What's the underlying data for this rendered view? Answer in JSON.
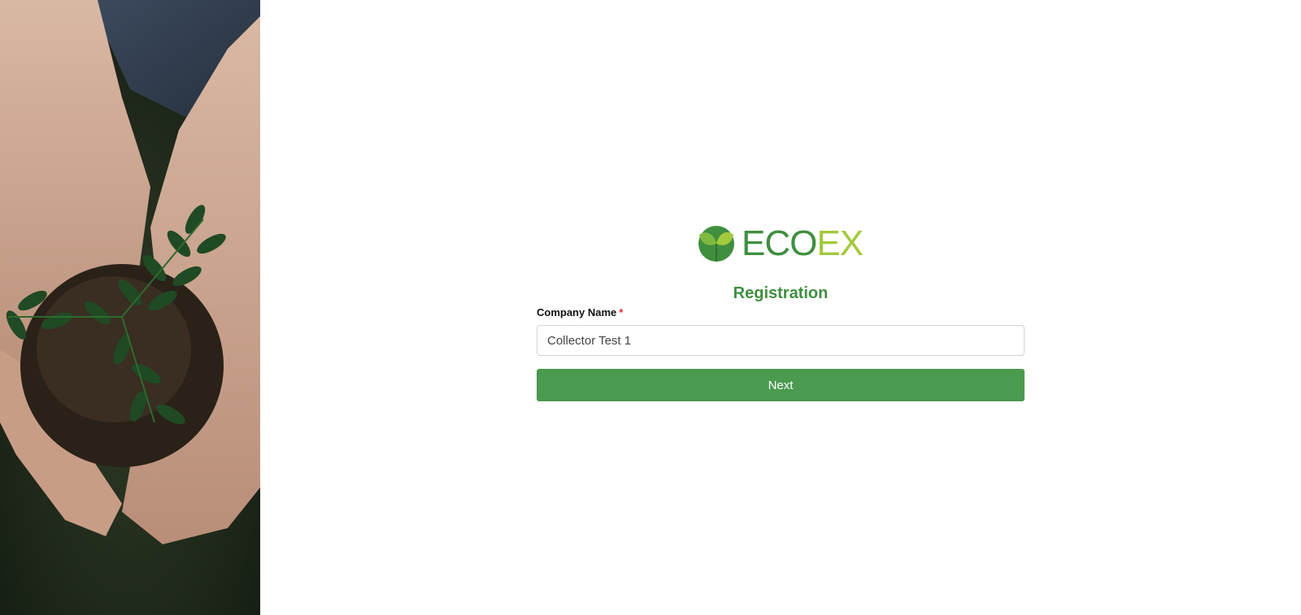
{
  "brand": {
    "name_left": "ECO",
    "name_right": "EX",
    "primary_color": "#3f8f3f",
    "secondary_color": "#a3c93c"
  },
  "side_image": {
    "icon": "hands-holding-seedling-photo"
  },
  "form": {
    "title": "Registration",
    "company_name": {
      "label": "Company Name",
      "required_mark": "*",
      "value": "Collector Test 1"
    },
    "next_label": "Next",
    "button_color": "#4a9a4f"
  }
}
